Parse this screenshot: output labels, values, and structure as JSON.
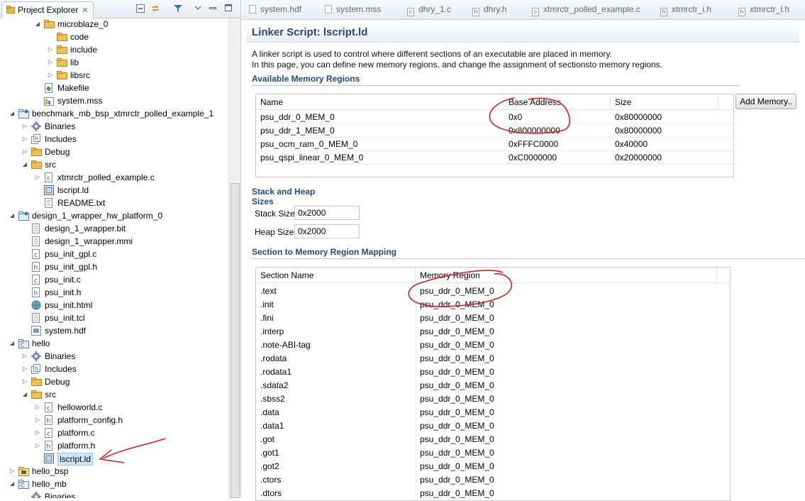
{
  "explorer": {
    "tab_title": "Project Explorer",
    "close_glyph": "✕",
    "toolbar": [
      "collapse-all-icon",
      "link-with-editor-icon",
      "filter-icon",
      "view-menu-icon",
      "minimize-icon",
      "maximize-icon"
    ],
    "tree": [
      {
        "label": "microblaze_0",
        "depth": 2,
        "expanded": true,
        "icon": "folder"
      },
      {
        "label": "code",
        "depth": 3,
        "expanded": null,
        "icon": "folder"
      },
      {
        "label": "include",
        "depth": 3,
        "expanded": false,
        "icon": "folder"
      },
      {
        "label": "lib",
        "depth": 3,
        "expanded": false,
        "icon": "folder"
      },
      {
        "label": "libsrc",
        "depth": 3,
        "expanded": false,
        "icon": "folder"
      },
      {
        "label": "Makefile",
        "depth": 2,
        "expanded": null,
        "icon": "makefile"
      },
      {
        "label": "system.mss",
        "depth": 2,
        "expanded": null,
        "icon": "mss"
      },
      {
        "label": "benchmark_mb_bsp_xtmrctr_polled_example_1",
        "depth": 0,
        "expanded": true,
        "icon": "project"
      },
      {
        "label": "Binaries",
        "depth": 1,
        "expanded": false,
        "icon": "gear"
      },
      {
        "label": "Includes",
        "depth": 1,
        "expanded": false,
        "icon": "includes"
      },
      {
        "label": "Debug",
        "depth": 1,
        "expanded": false,
        "icon": "folder"
      },
      {
        "label": "src",
        "depth": 1,
        "expanded": true,
        "icon": "folder"
      },
      {
        "label": "xtmrctr_polled_example.c",
        "depth": 2,
        "expanded": false,
        "icon": "c"
      },
      {
        "label": "lscript.ld",
        "depth": 2,
        "expanded": null,
        "icon": "ld"
      },
      {
        "label": "README.txt",
        "depth": 2,
        "expanded": null,
        "icon": "txt"
      },
      {
        "label": "design_1_wrapper_hw_platform_0",
        "depth": 0,
        "expanded": true,
        "icon": "project"
      },
      {
        "label": "design_1_wrapper.bit",
        "depth": 1,
        "expanded": null,
        "icon": "txt"
      },
      {
        "label": "design_1_wrapper.mmi",
        "depth": 1,
        "expanded": null,
        "icon": "txt"
      },
      {
        "label": "psu_init_gpl.c",
        "depth": 1,
        "expanded": null,
        "icon": "c"
      },
      {
        "label": "psu_init_gpl.h",
        "depth": 1,
        "expanded": null,
        "icon": "h"
      },
      {
        "label": "psu_init.c",
        "depth": 1,
        "expanded": null,
        "icon": "c"
      },
      {
        "label": "psu_init.h",
        "depth": 1,
        "expanded": null,
        "icon": "h"
      },
      {
        "label": "psu_init.html",
        "depth": 1,
        "expanded": null,
        "icon": "html"
      },
      {
        "label": "psu_init.tcl",
        "depth": 1,
        "expanded": null,
        "icon": "txt"
      },
      {
        "label": "system.hdf",
        "depth": 1,
        "expanded": null,
        "icon": "hdf"
      },
      {
        "label": "hello",
        "depth": 0,
        "expanded": true,
        "icon": "project-c"
      },
      {
        "label": "Binaries",
        "depth": 1,
        "expanded": false,
        "icon": "gear"
      },
      {
        "label": "Includes",
        "depth": 1,
        "expanded": false,
        "icon": "includes"
      },
      {
        "label": "Debug",
        "depth": 1,
        "expanded": false,
        "icon": "folder"
      },
      {
        "label": "src",
        "depth": 1,
        "expanded": true,
        "icon": "folder"
      },
      {
        "label": "helloworld.c",
        "depth": 2,
        "expanded": false,
        "icon": "c"
      },
      {
        "label": "platform_config.h",
        "depth": 2,
        "expanded": false,
        "icon": "h"
      },
      {
        "label": "platform.c",
        "depth": 2,
        "expanded": false,
        "icon": "c"
      },
      {
        "label": "platform.h",
        "depth": 2,
        "expanded": false,
        "icon": "h"
      },
      {
        "label": "lscript.ld",
        "depth": 2,
        "expanded": null,
        "icon": "ld",
        "selected": true
      },
      {
        "label": "hello_bsp",
        "depth": 0,
        "expanded": false,
        "icon": "bsp"
      },
      {
        "label": "hello_mb",
        "depth": 0,
        "expanded": true,
        "icon": "project-c"
      },
      {
        "label": "Binaries",
        "depth": 1,
        "expanded": null,
        "icon": "gear"
      }
    ]
  },
  "editor_tabs": [
    {
      "label": "system.hdf",
      "icon": "hdf"
    },
    {
      "label": "system.mss",
      "icon": "mss"
    },
    {
      "label": "dhry_1.c",
      "icon": "c"
    },
    {
      "label": "dhry.h",
      "icon": "h"
    },
    {
      "label": "xtmrctr_polled_example.c",
      "icon": "c"
    },
    {
      "label": "xtmrctr_i.h",
      "icon": "h"
    },
    {
      "label": "xtmrctr_l.h",
      "icon": "h"
    }
  ],
  "page": {
    "title": "Linker Script: lscript.ld",
    "description_1": "A linker script is used to control where different sections of an executable are placed in memory.",
    "description_2": "In this page, you can define new memory regions, and change the assignment of sectionsto memory regions."
  },
  "memory_regions": {
    "section_title": "Available Memory Regions",
    "headers": {
      "name": "Name",
      "base": "Base Address",
      "size": "Size"
    },
    "rows": [
      {
        "name": "psu_ddr_0_MEM_0",
        "base": "0x0",
        "size": "0x80000000"
      },
      {
        "name": "psu_ddr_1_MEM_0",
        "base": "0x800000000",
        "size": "0x80000000"
      },
      {
        "name": "psu_ocm_ram_0_MEM_0",
        "base": "0xFFFC0000",
        "size": "0x40000"
      },
      {
        "name": "psu_qspi_linear_0_MEM_0",
        "base": "0xC0000000",
        "size": "0x20000000"
      }
    ],
    "add_button": "Add Memory.."
  },
  "stack_heap": {
    "section_title": "Stack and Heap Sizes",
    "stack_label": "Stack Size",
    "stack_value": "0x2000",
    "heap_label": "Heap Size",
    "heap_value": "0x2000"
  },
  "mapping": {
    "section_title": "Section to Memory Region Mapping",
    "headers": {
      "section": "Section Name",
      "region": "Memory Region"
    },
    "rows": [
      {
        "section": ".text",
        "region": "psu_ddr_0_MEM_0"
      },
      {
        "section": ".init",
        "region": "psu_ddr_0_MEM_0"
      },
      {
        "section": ".fini",
        "region": "psu_ddr_0_MEM_0"
      },
      {
        "section": ".interp",
        "region": "psu_ddr_0_MEM_0"
      },
      {
        "section": ".note-ABI-tag",
        "region": "psu_ddr_0_MEM_0"
      },
      {
        "section": ".rodata",
        "region": "psu_ddr_0_MEM_0"
      },
      {
        "section": ".rodata1",
        "region": "psu_ddr_0_MEM_0"
      },
      {
        "section": ".sdata2",
        "region": "psu_ddr_0_MEM_0"
      },
      {
        "section": ".sbss2",
        "region": "psu_ddr_0_MEM_0"
      },
      {
        "section": ".data",
        "region": "psu_ddr_0_MEM_0"
      },
      {
        "section": ".data1",
        "region": "psu_ddr_0_MEM_0"
      },
      {
        "section": ".got",
        "region": "psu_ddr_0_MEM_0"
      },
      {
        "section": ".got1",
        "region": "psu_ddr_0_MEM_0"
      },
      {
        "section": ".got2",
        "region": "psu_ddr_0_MEM_0"
      },
      {
        "section": ".ctors",
        "region": "psu_ddr_0_MEM_0"
      },
      {
        "section": ".dtors",
        "region": "psu_ddr_0_MEM_0"
      }
    ]
  },
  "annotations": {
    "ink_color": "#d81e1e"
  }
}
